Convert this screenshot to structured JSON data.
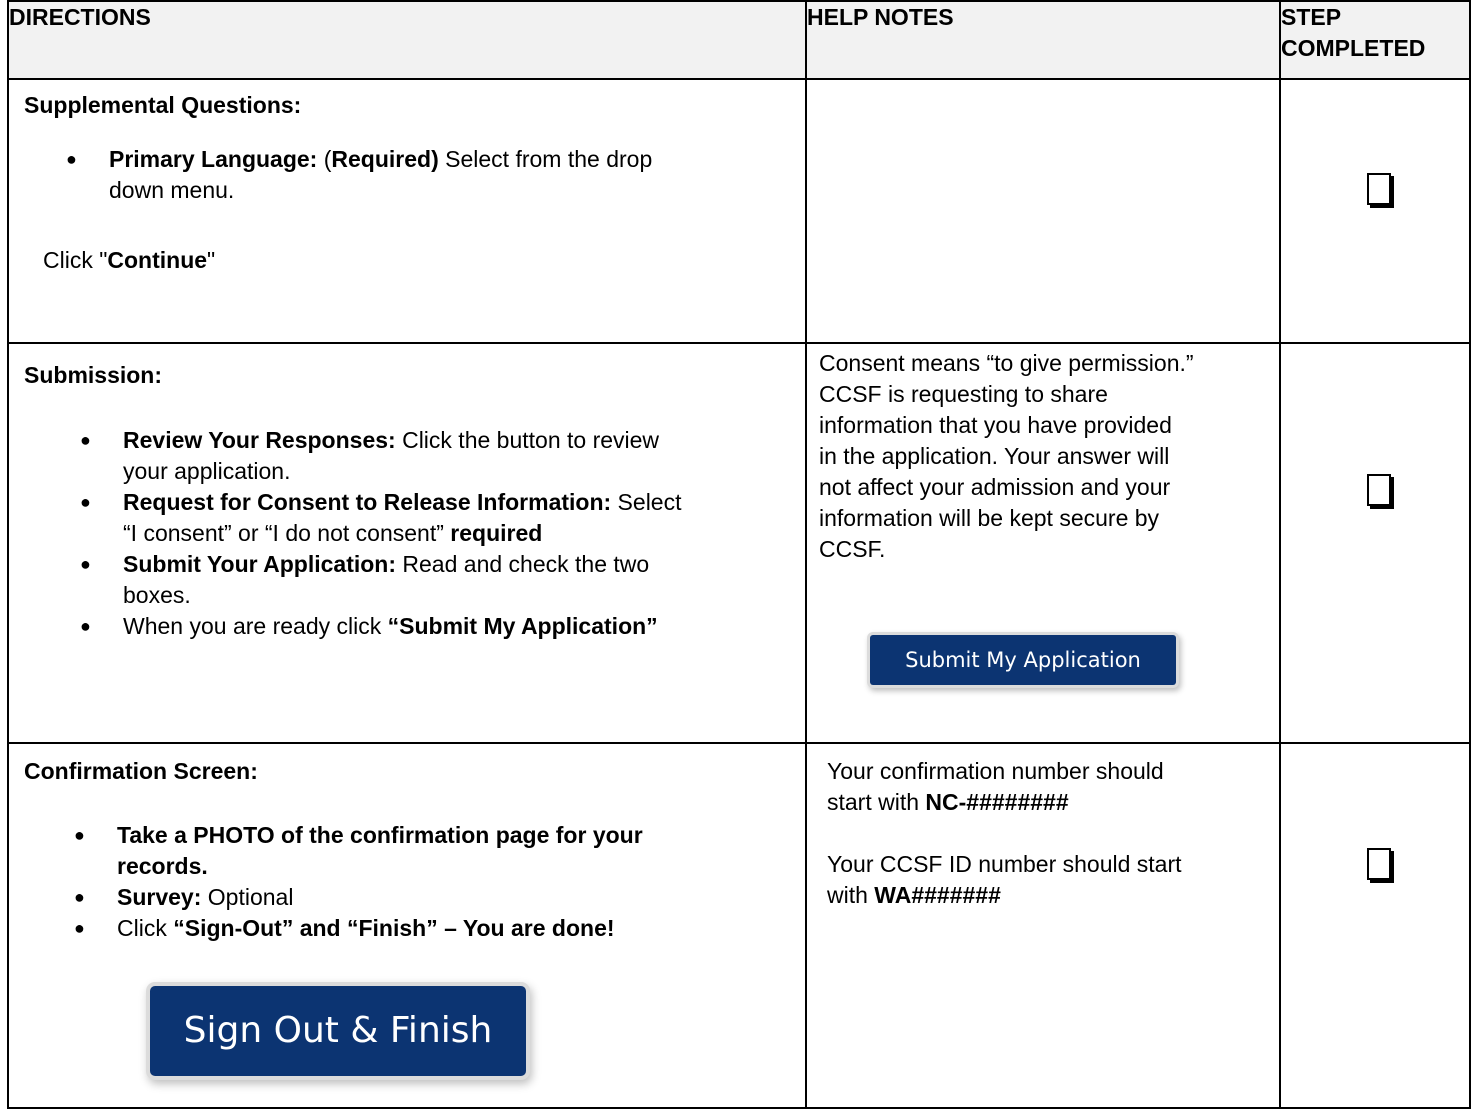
{
  "header": {
    "directions": "DIRECTIONS",
    "help_notes": "HELP NOTES",
    "step_completed_line1": "STEP",
    "step_completed_line2": "COMPLETED"
  },
  "rows": [
    {
      "title": "Supplemental Questions:",
      "bullets": [
        {
          "bold_label": "Primary Language:",
          "pre": " (",
          "bold_required": "Required)",
          "text_line1": " Select from the drop",
          "text_line2": "down menu."
        }
      ],
      "footer_pre": "Click \"",
      "footer_bold": "Continue",
      "footer_post": "\""
    },
    {
      "title": "Submission:",
      "bullets": [
        {
          "bold": "Review Your Responses:",
          "text_line1": " Click the button to review",
          "text_line2": "your application."
        },
        {
          "bold": "Request for Consent to Release Information:",
          "text_line1": " Select",
          "text_line2a": "“I consent” or “I do not consent” ",
          "text_line2b": "required"
        },
        {
          "bold": "Submit Your Application:",
          "text_line1": " Read and check the two",
          "text_line2": "boxes."
        },
        {
          "text": "When you are ready click ",
          "bold": "“Submit My Application”"
        }
      ],
      "help_lines": [
        "Consent means “to give permission.”",
        "CCSF is requesting to share",
        "information that you have provided",
        "in the application.  Your answer will",
        "not affect your admission and your",
        "information will be kept secure by",
        "CCSF."
      ],
      "button_label": "Submit My Application"
    },
    {
      "title": "Confirmation Screen:",
      "bullets": [
        {
          "bold_line1": "Take a PHOTO of the confirmation page for your",
          "bold_line2": "records."
        },
        {
          "bold": "Survey:",
          "text": " Optional"
        },
        {
          "text": "Click ",
          "bold": "“Sign-Out” and “Finish” – You are done!"
        }
      ],
      "help": {
        "conf_line1": "Your confirmation number should",
        "conf_line2_pre": "start with ",
        "conf_line2_bold": "NC-########",
        "id_line1": "Your CCSF ID number should start",
        "id_line2_pre": "with ",
        "id_line2_bold": "WA#######"
      },
      "button_label": "Sign Out & Finish"
    }
  ],
  "colors": {
    "button_bg": "#0c3472",
    "header_bg": "#f2f2f2"
  },
  "icons": {
    "checkbox": "checkbox-icon",
    "bullet": "bullet-dot"
  }
}
